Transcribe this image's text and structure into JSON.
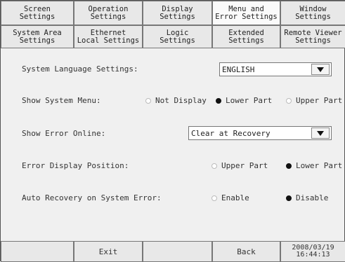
{
  "tabs_row1": [
    {
      "line1": "Screen",
      "line2": "Settings"
    },
    {
      "line1": "Operation",
      "line2": "Settings"
    },
    {
      "line1": "Display",
      "line2": "Settings"
    },
    {
      "line1": "Menu and",
      "line2": "Error Settings"
    },
    {
      "line1": "Window",
      "line2": "Settings"
    }
  ],
  "tabs_row2": [
    {
      "line1": "System Area",
      "line2": "Settings"
    },
    {
      "line1": "Ethernet",
      "line2": "Local Settings"
    },
    {
      "line1": "Logic",
      "line2": "Settings"
    },
    {
      "line1": "Extended",
      "line2": "Settings"
    },
    {
      "line1": "Remote Viewer",
      "line2": "Settings"
    }
  ],
  "language": {
    "label": "System Language Settings:",
    "value": "ENGLISH"
  },
  "system_menu": {
    "label": "Show System Menu:",
    "options": [
      "Not Display",
      "Lower Part",
      "Upper Part"
    ],
    "selected": "Lower Part"
  },
  "error_online": {
    "label": "Show Error Online:",
    "value": "Clear at Recovery"
  },
  "error_position": {
    "label": "Error Display Position:",
    "options": [
      "Upper Part",
      "Lower Part"
    ],
    "selected": "Lower Part"
  },
  "auto_recovery": {
    "label": "Auto Recovery on System Error:",
    "options": [
      "Enable",
      "Disable"
    ],
    "selected": "Disable"
  },
  "footer": {
    "exit": "Exit",
    "back": "Back",
    "date": "2008/03/19",
    "time": "16:44:13"
  },
  "icons": {
    "dropdown_arrow": "triangle-down-icon",
    "radio_selected": "radio-filled-icon",
    "radio_unselected": "radio-empty-icon"
  }
}
